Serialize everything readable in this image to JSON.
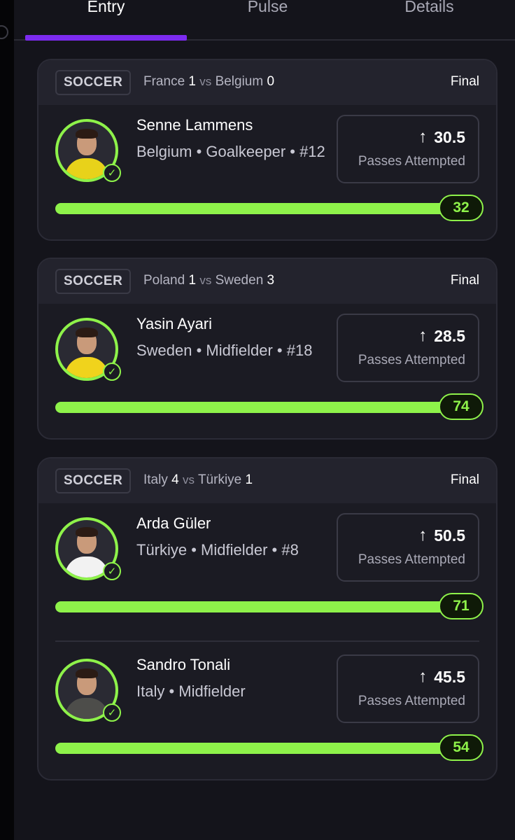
{
  "tabs": [
    {
      "label": "Entry",
      "active": true
    },
    {
      "label": "Pulse",
      "active": false
    },
    {
      "label": "Details",
      "active": false
    }
  ],
  "accent_color": "#8ef24a",
  "tab_accent_color": "#7c2bf0",
  "cards": [
    {
      "sport": "SOCCER",
      "home_team": "France",
      "home_score": "1",
      "vs": "vs",
      "away_team": "Belgium",
      "away_score": "0",
      "status": "Final",
      "players": [
        {
          "name": "Senne Lammens",
          "meta": "Belgium • Goalkeeper • #12",
          "stat_value": "30.5",
          "stat_label": "Passes Attempted",
          "direction_icon": "arrow-up-icon",
          "result": "32",
          "progress_pct": 100
        }
      ]
    },
    {
      "sport": "SOCCER",
      "home_team": "Poland",
      "home_score": "1",
      "vs": "vs",
      "away_team": "Sweden",
      "away_score": "3",
      "status": "Final",
      "players": [
        {
          "name": "Yasin Ayari",
          "meta": "Sweden • Midfielder • #18",
          "stat_value": "28.5",
          "stat_label": "Passes Attempted",
          "direction_icon": "arrow-up-icon",
          "result": "74",
          "progress_pct": 100
        }
      ]
    },
    {
      "sport": "SOCCER",
      "home_team": "Italy",
      "home_score": "4",
      "vs": "vs",
      "away_team": "Türkiye",
      "away_score": "1",
      "status": "Final",
      "players": [
        {
          "name": "Arda Güler",
          "meta": "Türkiye • Midfielder • #8",
          "stat_value": "50.5",
          "stat_label": "Passes Attempted",
          "direction_icon": "arrow-up-icon",
          "result": "71",
          "progress_pct": 100
        },
        {
          "name": "Sandro Tonali",
          "meta": "Italy • Midfielder",
          "stat_value": "45.5",
          "stat_label": "Passes Attempted",
          "direction_icon": "arrow-up-icon",
          "result": "54",
          "progress_pct": 100
        }
      ]
    }
  ]
}
